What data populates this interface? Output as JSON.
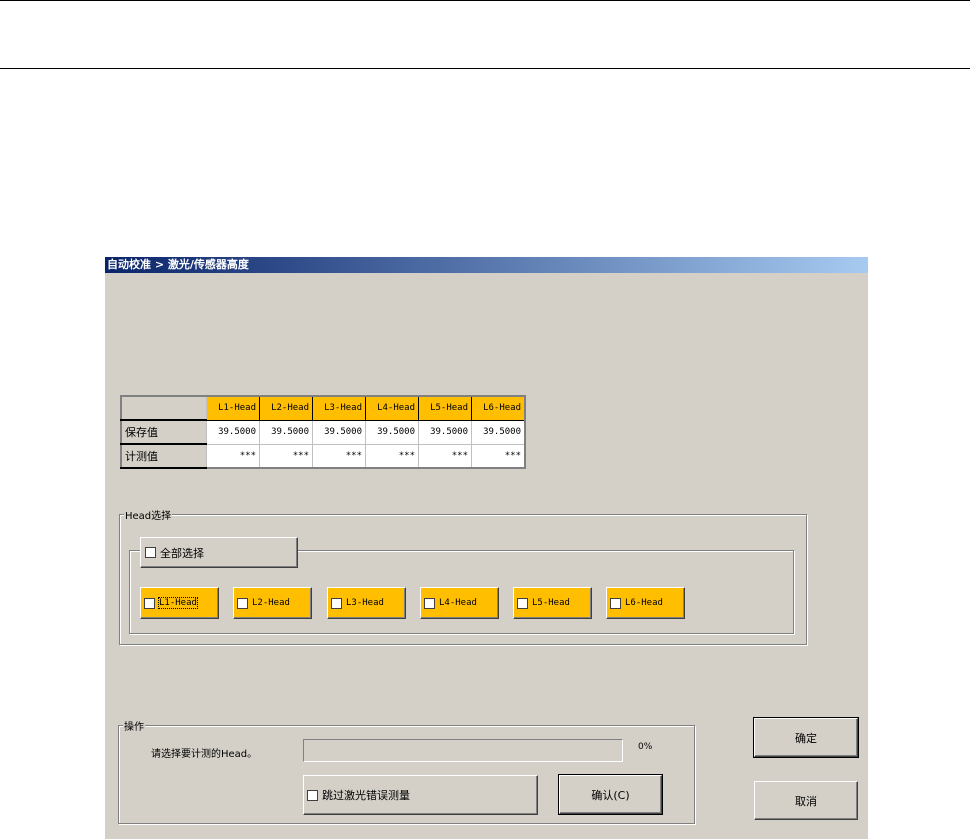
{
  "window": {
    "title": "自动校准 > 激光/传感器高度"
  },
  "table": {
    "headers": [
      "L1-Head",
      "L2-Head",
      "L3-Head",
      "L4-Head",
      "L5-Head",
      "L6-Head"
    ],
    "rows": [
      {
        "label": "保存值",
        "values": [
          "39.5000",
          "39.5000",
          "39.5000",
          "39.5000",
          "39.5000",
          "39.5000"
        ]
      },
      {
        "label": "计测值",
        "values": [
          "***",
          "***",
          "***",
          "***",
          "***",
          "***"
        ]
      }
    ]
  },
  "head_select": {
    "label": "Head选择",
    "select_all": "全部选择",
    "heads": [
      "L1-Head",
      "L2-Head",
      "L3-Head",
      "L4-Head",
      "L5-Head",
      "L6-Head"
    ]
  },
  "operation": {
    "label": "操作",
    "prompt": "请选择要计测的Head。",
    "progress_text": "0%",
    "progress": 0,
    "skip_label": "跳过激光错误测量",
    "confirm_label": "确认(C)"
  },
  "buttons": {
    "ok": "确定",
    "cancel": "取消"
  }
}
